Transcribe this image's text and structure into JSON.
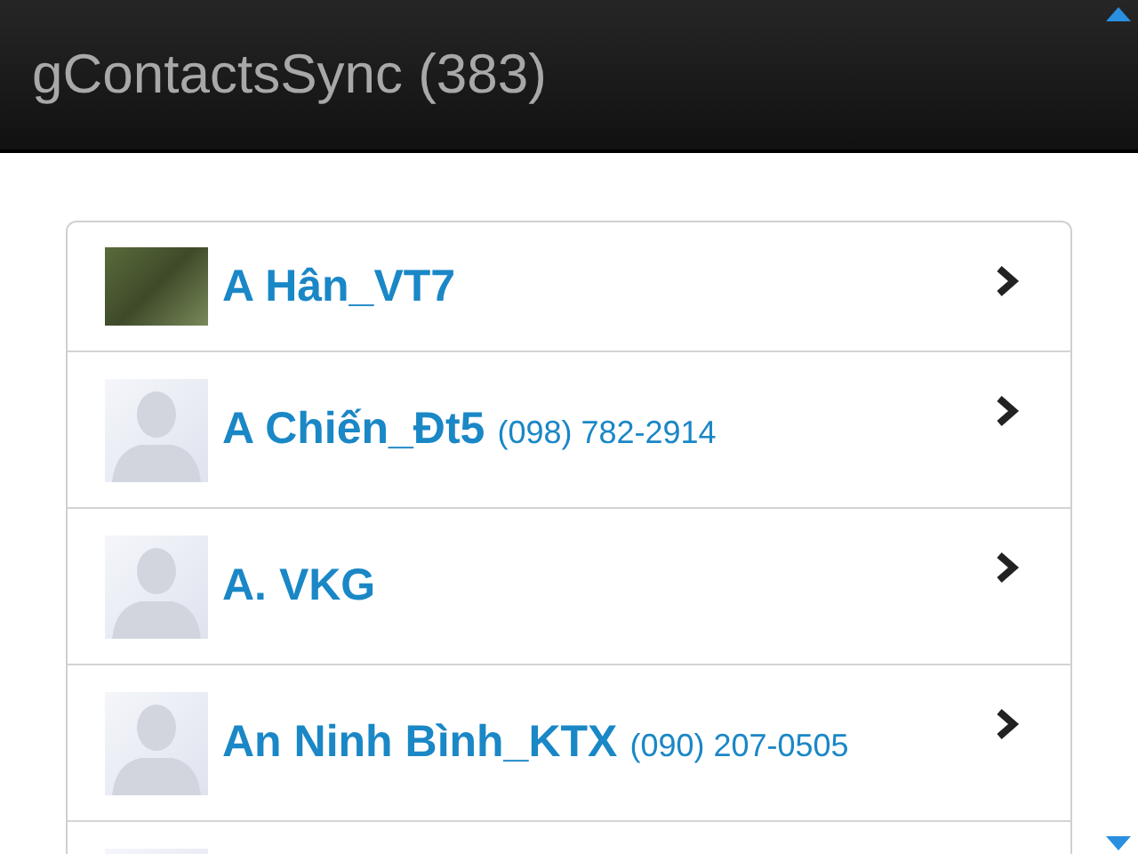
{
  "header": {
    "title": "gContactsSync (383)"
  },
  "contacts": [
    {
      "kind": "photo",
      "name": "A Hân_VT7"
    },
    {
      "kind": "silhouette",
      "name": "A Chiến_Đt5",
      "phone": "(098) 782-2914"
    },
    {
      "kind": "silhouette",
      "name": "A. VKG"
    },
    {
      "kind": "silhouette",
      "name": "An Ninh Bình_KTX",
      "phone": "(090) 207-0505"
    },
    {
      "kind": "silhouette"
    }
  ]
}
